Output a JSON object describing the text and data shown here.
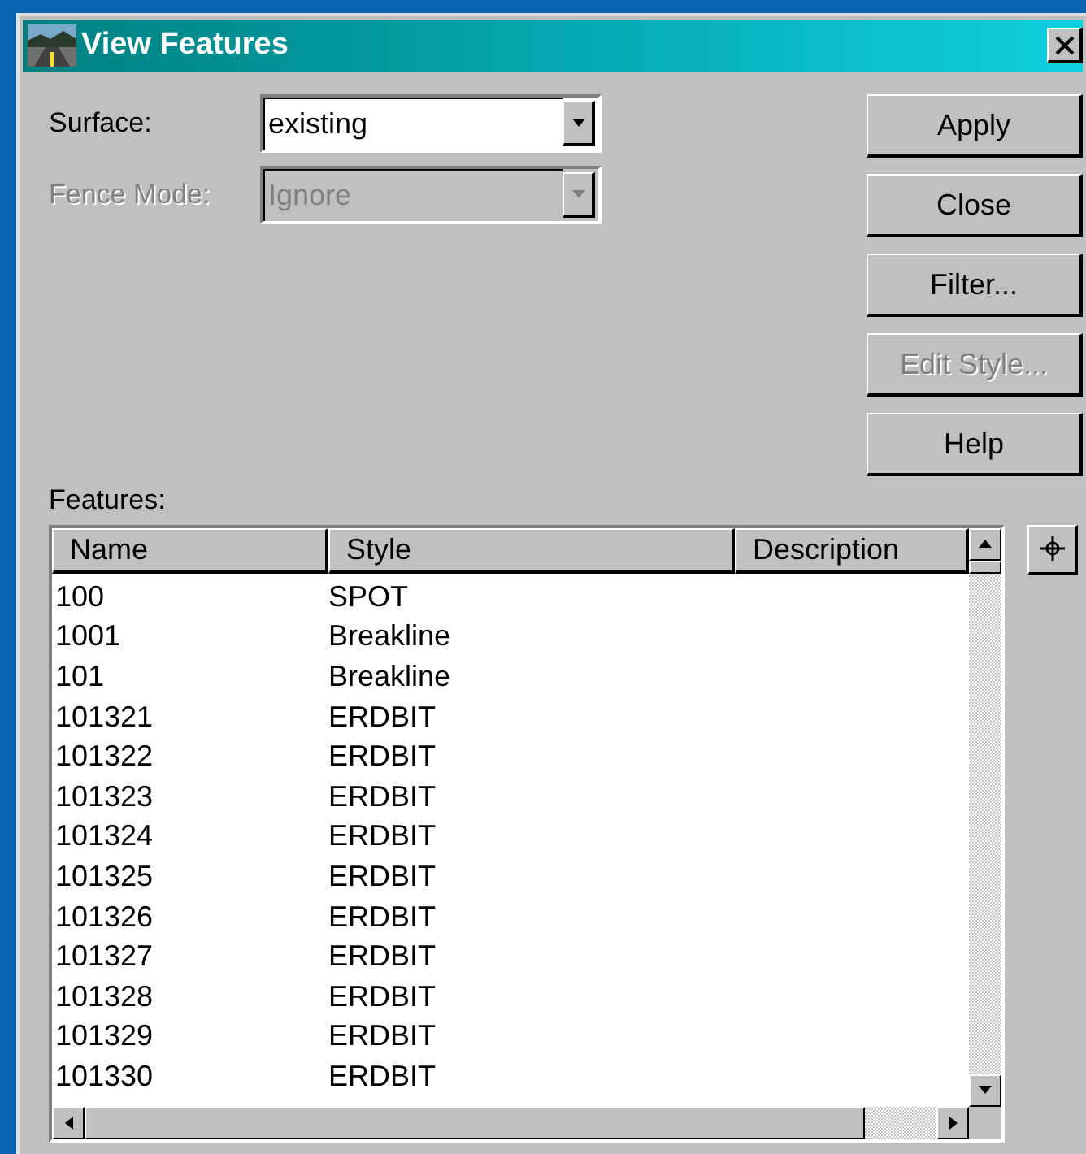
{
  "window": {
    "title": "View Features"
  },
  "fields": [
    {
      "label": "Surface:",
      "value": "existing",
      "disabled": false
    },
    {
      "label": "Fence Mode:",
      "value": "Ignore",
      "disabled": true
    }
  ],
  "buttons": [
    {
      "label": "Apply",
      "disabled": false
    },
    {
      "label": "Close",
      "disabled": false
    },
    {
      "label": "Filter...",
      "disabled": false
    },
    {
      "label": "Edit Style...",
      "disabled": true
    },
    {
      "label": "Help",
      "disabled": false
    }
  ],
  "features": {
    "label": "Features:",
    "columns": [
      "Name",
      "Style",
      "Description"
    ],
    "rows": [
      [
        "100",
        "SPOT"
      ],
      [
        "1001",
        "Breakline"
      ],
      [
        "101",
        "Breakline"
      ],
      [
        "101321",
        "ERDBIT"
      ],
      [
        "101322",
        "ERDBIT"
      ],
      [
        "101323",
        "ERDBIT"
      ],
      [
        "101324",
        "ERDBIT"
      ],
      [
        "101325",
        "ERDBIT"
      ],
      [
        "101326",
        "ERDBIT"
      ],
      [
        "101327",
        "ERDBIT"
      ],
      [
        "101328",
        "ERDBIT"
      ],
      [
        "101329",
        "ERDBIT"
      ],
      [
        "101330",
        "ERDBIT"
      ]
    ]
  }
}
